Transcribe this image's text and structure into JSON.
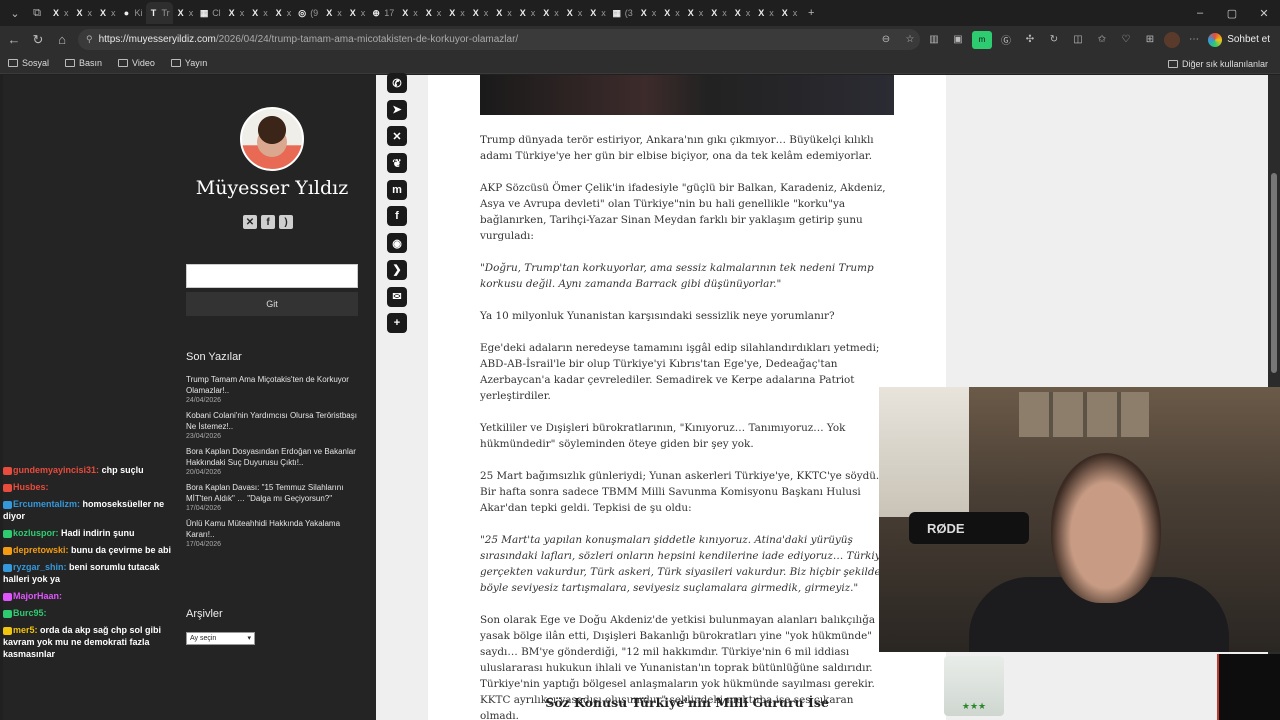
{
  "browser": {
    "tabs": [
      {
        "icon": "X",
        "label": "x"
      },
      {
        "icon": "X",
        "label": "x"
      },
      {
        "icon": "X",
        "label": "x"
      },
      {
        "icon": "●",
        "label": "Ki"
      },
      {
        "icon": "T",
        "label": "Tr",
        "active": true
      },
      {
        "icon": "X",
        "label": "x"
      },
      {
        "icon": "▦",
        "label": "Cl"
      },
      {
        "icon": "X",
        "label": "x"
      },
      {
        "icon": "X",
        "label": "x"
      },
      {
        "icon": "X",
        "label": "x"
      },
      {
        "icon": "◎",
        "label": "(9"
      },
      {
        "icon": "X",
        "label": "x"
      },
      {
        "icon": "X",
        "label": "x"
      },
      {
        "icon": "⊕",
        "label": "17"
      },
      {
        "icon": "X",
        "label": "x"
      },
      {
        "icon": "X",
        "label": "x"
      },
      {
        "icon": "X",
        "label": "x"
      },
      {
        "icon": "X",
        "label": "x"
      },
      {
        "icon": "X",
        "label": "x"
      },
      {
        "icon": "X",
        "label": "x"
      },
      {
        "icon": "X",
        "label": "x"
      },
      {
        "icon": "X",
        "label": "x"
      },
      {
        "icon": "X",
        "label": "x"
      },
      {
        "icon": "▦",
        "label": "(3"
      },
      {
        "icon": "X",
        "label": "x"
      },
      {
        "icon": "X",
        "label": "x"
      },
      {
        "icon": "X",
        "label": "x"
      },
      {
        "icon": "X",
        "label": "x"
      },
      {
        "icon": "X",
        "label": "x"
      },
      {
        "icon": "X",
        "label": "x"
      },
      {
        "icon": "X",
        "label": "x"
      }
    ],
    "new_tab": "+",
    "window_controls": [
      "–",
      "▢",
      "✕"
    ],
    "url_host": "https://muyesseryildiz.com",
    "url_path": "/2026/04/24/trump-tamam-ama-micotakisten-de-korkuyor-olamazlar/",
    "chat_button": "Sohbet et",
    "bookmarks": [
      "Sosyal",
      "Basın",
      "Video",
      "Yayın"
    ],
    "bookmarks_right": "Diğer sık kullanılanlar"
  },
  "sidebar": {
    "site_title": "Müyesser Yıldız",
    "social_icons": [
      "x-icon",
      "facebook-icon",
      "rss-icon"
    ],
    "search_button": "Git",
    "recent_heading": "Son Yazılar",
    "recent_posts": [
      {
        "title": "Trump Tamam Ama Miçotakis'ten de Korkuyor Olamazlar!..",
        "date": "24/04/2026"
      },
      {
        "title": "Kobani Colani'nin Yardımcısı Olursa Teröristbaşı Ne İstemez!..",
        "date": "23/04/2026"
      },
      {
        "title": "Bora Kaplan Dosyasından Erdoğan ve Bakanlar Hakkındaki Suç Duyurusu Çıktı!..",
        "date": "20/04/2026"
      },
      {
        "title": "Bora Kaplan Davası: \"15 Temmuz Silahlarını MİT'ten Aldık\" … \"Dalga mı Geçiyorsun?\"",
        "date": "17/04/2026"
      },
      {
        "title": "Ünlü Kamu Müteahhidi Hakkında Yakalama Kararı!..",
        "date": "17/04/2026"
      }
    ],
    "archive_heading": "Arşivler",
    "archive_select": "Ay seçin"
  },
  "chat": [
    {
      "user": "gundemyayincisi31:",
      "color": "#e74c3c",
      "text": "chp suçlu"
    },
    {
      "user": "Husbes:",
      "color": "#e74c3c",
      "text": ""
    },
    {
      "user": "Ercumentalizm:",
      "color": "#3498db",
      "text": "homoseksüeller ne diyor"
    },
    {
      "user": "kozluspor:",
      "color": "#2ecc71",
      "text": "Hadi indirin şunu"
    },
    {
      "user": "depretowski:",
      "color": "#f39c12",
      "text": "bunu da çevirme be abi"
    },
    {
      "user": "ryzgar_shin:",
      "color": "#3498db",
      "text": "beni sorumlu tutacak halleri yok ya"
    },
    {
      "user": "MajorHaan:",
      "color": "#e056fd",
      "text": ""
    },
    {
      "user": "Burc95:",
      "color": "#2ecc71",
      "text": ""
    },
    {
      "user": "mer5:",
      "color": "#f1c40f",
      "text": "orda da akp sağ chp sol gibi kavram yok mu ne demokrati fazla kasmasınlar"
    }
  ],
  "share_icons": [
    "whatsapp-icon",
    "telegram-icon",
    "x-icon",
    "bluesky-icon",
    "mastodon-icon",
    "facebook-icon",
    "reddit-icon",
    "pocket-icon",
    "email-icon",
    "add-icon"
  ],
  "article": {
    "paragraphs": [
      "Trump dünyada terör estiriyor, Ankara'nın gıkı çıkmıyor… Büyükelçi kılıklı adamı Türkiye'ye her gün bir elbise biçiyor, ona da tek kelâm edemiyorlar.",
      "AKP Sözcüsü Ömer Çelik'in ifadesiyle \"güçlü bir Balkan, Karadeniz, Akdeniz, Asya ve Avrupa devleti\" olan Türkiye\"nin bu hali genellikle \"korku\"ya bağlanırken, Tarihçi-Yazar Sinan Meydan farklı bir yaklaşım getirip şunu vurguladı:",
      "\"Doğru, Trump'tan korkuyorlar, ama sessiz kalmalarının tek nedeni Trump korkusu değil. Aynı zamanda Barrack gibi düşünüyorlar.\"",
      "Ya 10 milyonluk Yunanistan karşısındaki sessizlik neye yorumlanır?",
      "Ege'deki adaların neredeyse tamamını işgâl edip silahlandırdıkları yetmedi; ABD-AB-İsrail'le bir olup Türkiye'yi Kıbrıs'tan Ege'ye, Dedeağaç'tan Azerbaycan'a kadar çevrelediler. Semadirek ve Kerpe adalarına Patriot yerleştirdiler.",
      "Yetkililer ve Dışişleri bürokratlarının, \"Kınıyoruz… Tanımıyoruz… Yok hükmündedir\" söyleminden öteye giden bir şey yok.",
      "25 Mart bağımsızlık günleriydi; Yunan askerleri Türkiye'ye, KKTC'ye söydü. Bir hafta sonra sadece TBMM Milli Savunma Komisyonu Başkanı Hulusi Akar'dan tepki geldi. Tepkisi de şu oldu:",
      "\"25 Mart'ta yapılan konuşmaları şiddetle kınıyoruz. Atina'daki yürüyüş sırasındaki lafları, sözleri onların hepsini kendilerine iade ediyoruz… Türkiye gerçekten vakurdur, Türk askeri, Türk siyasileri vakurdur. Biz hiçbir şekilde böyle seviyesiz tartışmalara, seviyesiz suçlamalara girmedik, girmeyiz.\"",
      "Son olarak Ege ve Doğu Akdeniz'de yetkisi bulunmayan alanları balıkçılığa yasak bölge ilân etti, Dışişleri Bakanlığı bürokratları yine \"yok hükmünde\" saydı… BM'ye gönderdiği, \"12 mil hakkımdır. Türkiye'nin 6 mil iddiası uluslararası hukukun ihlali ve Yunanistan'ın toprak bütünlüğüne saldırıdır. Türkiye'nin yaptığı bölgesel anlaşmaların yok hükmünde sayılması gerekir. KKTC ayrılıkçı yasadışı oluşumdur\" şeklindeki mektuba ise ses çıkaran olmadı."
    ],
    "subheading": "Söz Konusu Türkiye'nin Milli Gururu İse"
  },
  "webcam": {
    "mic_brand": "RØDE"
  },
  "cup_label": "★★★"
}
